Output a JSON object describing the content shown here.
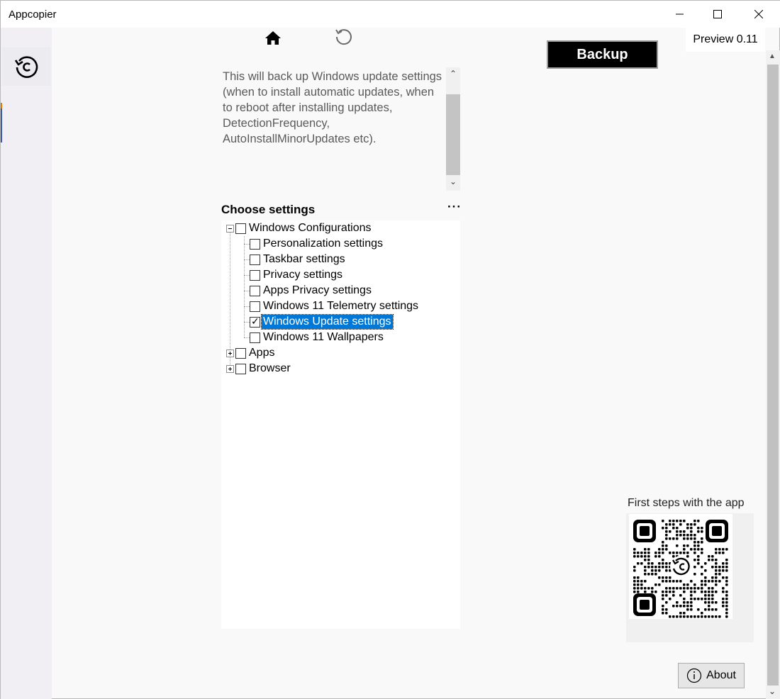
{
  "window": {
    "title": "Appcopier",
    "minimize_icon": "minimize-icon",
    "maximize_icon": "maximize-icon",
    "close_icon": "close-icon"
  },
  "nav": {
    "items": [
      {
        "icon": "restore-icon",
        "selected": true
      }
    ]
  },
  "toolbar": {
    "home_icon": "home-icon",
    "refresh_icon": "refresh-icon",
    "backup_label": "Backup",
    "version": "Preview 0.11"
  },
  "description": {
    "text": "This will back up Windows update settings (when to install automatic updates, when to reboot after installing updates, DetectionFrequency, AutoInstallMinorUpdates etc)."
  },
  "settings": {
    "heading": "Choose settings",
    "more_label": "···",
    "tree": [
      {
        "label": "Windows Configurations",
        "expanded": true,
        "checked": false,
        "children": [
          {
            "label": "Personalization settings",
            "checked": false
          },
          {
            "label": "Taskbar settings",
            "checked": false
          },
          {
            "label": "Privacy settings",
            "checked": false
          },
          {
            "label": "Apps Privacy settings",
            "checked": false
          },
          {
            "label": "Windows 11 Telemetry settings",
            "checked": false
          },
          {
            "label": "Windows Update settings",
            "checked": true,
            "selected": true
          },
          {
            "label": "Windows 11 Wallpapers",
            "checked": false
          }
        ]
      },
      {
        "label": "Apps",
        "expanded": false,
        "checked": false
      },
      {
        "label": "Browser",
        "expanded": false,
        "checked": false
      }
    ]
  },
  "help": {
    "title": "First steps with the app",
    "qr_icon": "qr-code-icon",
    "about_label": "About",
    "about_icon": "info-icon"
  },
  "colors": {
    "selection": "#0078d7",
    "backup_bg": "#000000",
    "sidebar_bg": "#f1eff4"
  }
}
